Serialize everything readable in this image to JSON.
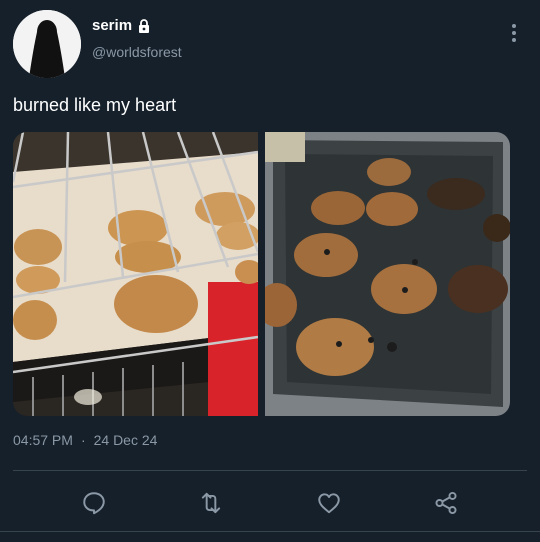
{
  "author": {
    "display_name": "serim",
    "handle": "@worldsforest",
    "avatar_icon": "silhouette-avatar",
    "protected_icon": "lock-icon"
  },
  "tweet": {
    "text": "burned like my heart",
    "time": "04:57 PM",
    "separator": "·",
    "date": "24 Dec 24",
    "media": [
      {
        "description_icon": "cookies-in-oven-photo"
      },
      {
        "description_icon": "burned-cookies-tray-photo"
      }
    ]
  },
  "actions": [
    {
      "name": "reply",
      "icon": "reply-icon"
    },
    {
      "name": "retweet",
      "icon": "retweet-icon"
    },
    {
      "name": "like",
      "icon": "heart-icon"
    },
    {
      "name": "share",
      "icon": "share-icon"
    }
  ],
  "colors": {
    "background": "#15202b",
    "secondary_text": "#8b98a5",
    "divider": "#38444d"
  }
}
